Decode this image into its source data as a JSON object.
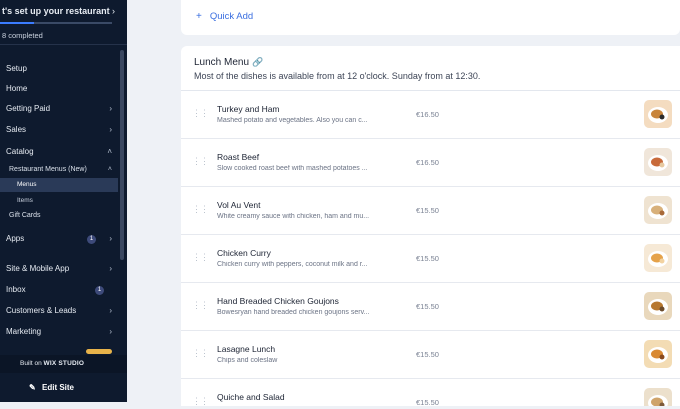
{
  "sidebar": {
    "setup_title": "t's set up your restaurant",
    "completed": "8 completed",
    "setup_progress": 0.3,
    "items": [
      {
        "label": "Setup"
      },
      {
        "label": "Home"
      },
      {
        "label": "Getting Paid"
      },
      {
        "label": "Sales"
      },
      {
        "label": "Catalog"
      },
      {
        "label": "Apps",
        "badge": "1"
      },
      {
        "label": "Site & Mobile App"
      },
      {
        "label": "Inbox",
        "badge": "1"
      },
      {
        "label": "Customers & Leads"
      },
      {
        "label": "Marketing"
      }
    ],
    "catalog_sub": {
      "label": "Restaurant Menus (New)",
      "children": [
        {
          "label": "Menus"
        },
        {
          "label": "Items"
        }
      ],
      "gift_cards": "Gift Cards"
    },
    "built_on": "Built on",
    "built_brand": "WIX STUDIO",
    "edit_site": "Edit Site"
  },
  "quick_add": {
    "label": "Quick Add"
  },
  "menu": {
    "title": "Lunch Menu",
    "description": "Most of the dishes is available from at 12 o'clock. Sunday from at 12:30.",
    "items": [
      {
        "name": "Turkey and Ham",
        "description": "Mashed potato and vegetables. Also you can c...",
        "price": "€16.50"
      },
      {
        "name": "Roast Beef",
        "description": "Slow cooked roast beef with mashed potatoes ...",
        "price": "€16.50"
      },
      {
        "name": "Vol Au Vent",
        "description": "White creamy sauce with chicken, ham and mu...",
        "price": "€15.50"
      },
      {
        "name": "Chicken Curry",
        "description": "Chicken curry with peppers, coconut milk and r...",
        "price": "€15.50"
      },
      {
        "name": "Hand Breaded Chicken Goujons",
        "description": "Bowesryan hand breaded chicken goujons serv...",
        "price": "€15.50"
      },
      {
        "name": "Lasagne Lunch",
        "description": "Chips and coleslaw",
        "price": "€15.50"
      },
      {
        "name": "Quiche and Salad",
        "description": "",
        "price": "€15.50"
      }
    ]
  },
  "colors": {
    "sidebar_bg": "#0e1a2e",
    "accent": "#3b6fe0",
    "page_bg": "#eef1f6"
  }
}
